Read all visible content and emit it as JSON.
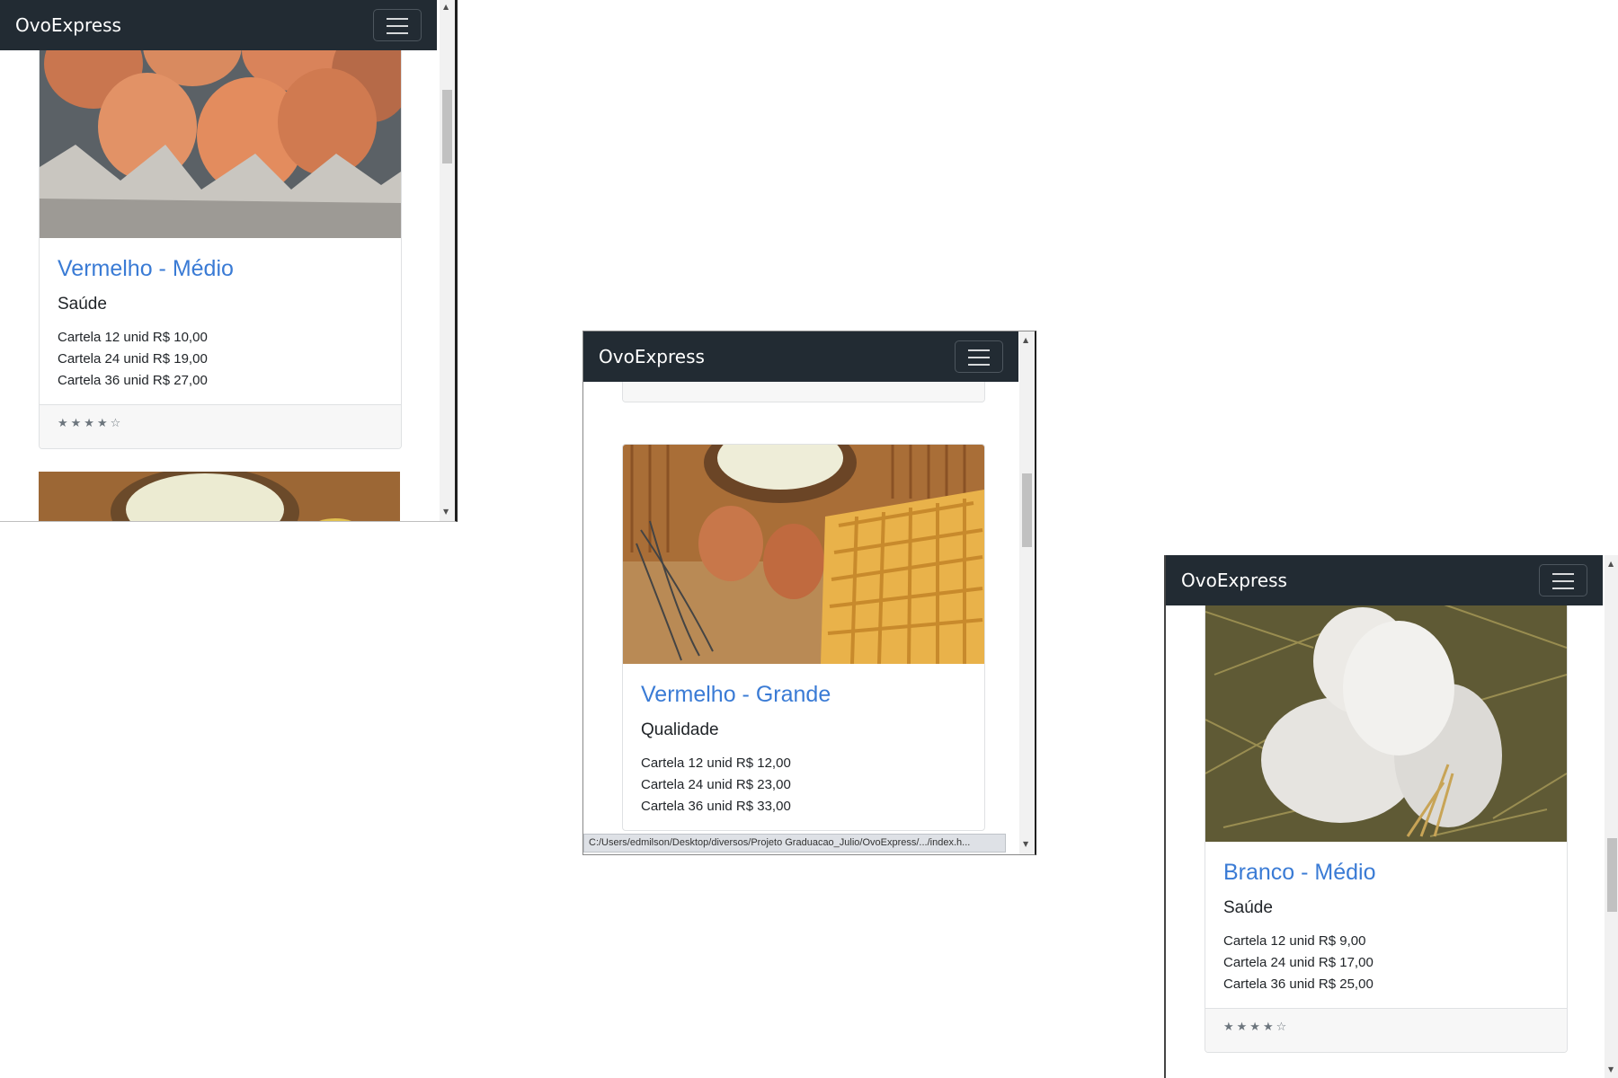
{
  "windows": [
    {
      "brand": "OvoExpress",
      "cards": [
        {
          "title": "Vermelho - Médio",
          "subtitle": "Saúde",
          "prices": [
            "Cartela 12 unid R$ 10,00",
            "Cartela 24 unid R$ 19,00",
            "Cartela 36 unid R$ 27,00"
          ],
          "rating": "★★★★☆"
        }
      ]
    },
    {
      "brand": "OvoExpress",
      "top_rating": "★★★★☆",
      "cards": [
        {
          "title": "Vermelho - Grande",
          "subtitle": "Qualidade",
          "prices": [
            "Cartela 12 unid R$ 12,00",
            "Cartela 24 unid R$ 23,00",
            "Cartela 36 unid R$ 33,00"
          ]
        }
      ],
      "status_url": "C:/Users/edmilson/Desktop/diversos/Projeto Graduacao_Julio/OvoExpress/.../index.h..."
    },
    {
      "brand": "OvoExpress",
      "cards": [
        {
          "title": "Branco - Médio",
          "subtitle": "Saúde",
          "prices": [
            "Cartela 12 unid R$ 9,00",
            "Cartela 24 unid R$ 17,00",
            "Cartela 36 unid R$ 25,00"
          ],
          "rating": "★★★★☆"
        }
      ]
    }
  ],
  "colors": {
    "navbar": "#222b33",
    "title_link": "#3a7bd5",
    "footer_bg": "#f7f7f7"
  },
  "icons": [
    "menu-icon",
    "scroll-up-arrow-icon",
    "scroll-down-arrow-icon"
  ]
}
